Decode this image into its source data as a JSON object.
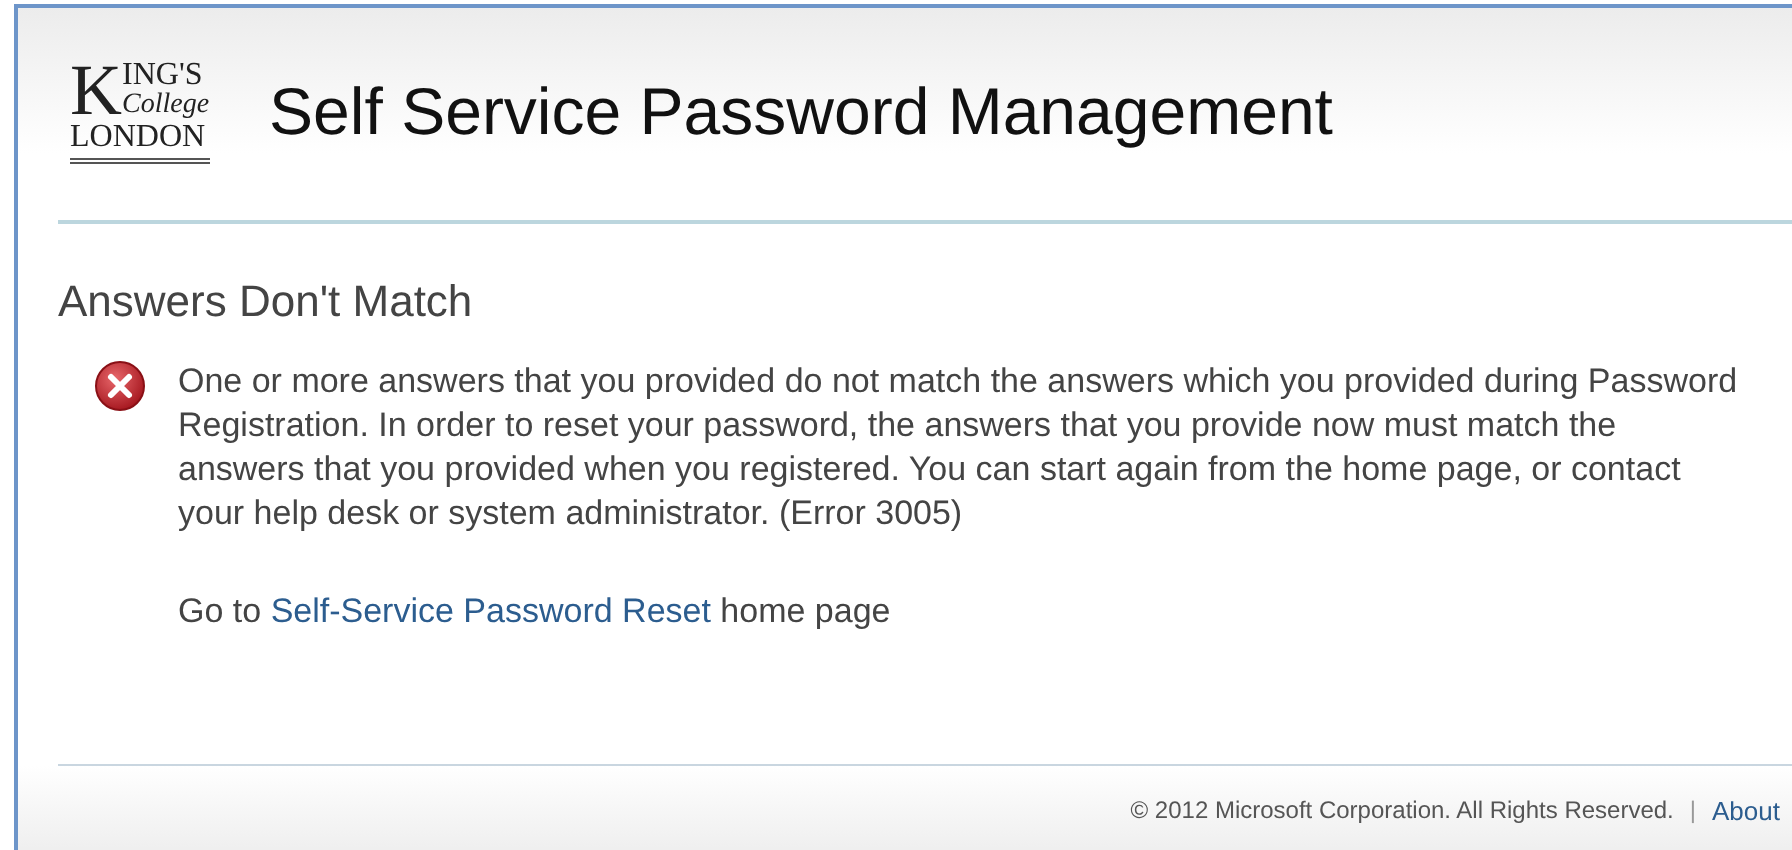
{
  "logo": {
    "initial": "K",
    "top": "ING'S",
    "middle": "College",
    "bottom": "LONDON"
  },
  "header": {
    "title": "Self Service Password Management"
  },
  "error": {
    "heading": "Answers Don't Match",
    "message": "One or more answers that you provided do not match the answers which you provided during Password Registration. In order to reset your password, the answers that you provide now must match the answers that you provided when you registered. You can start again from the home page, or contact your help desk or system administrator. (Error 3005)"
  },
  "home_link": {
    "before": "Go to",
    "link": "Self-Service Password Reset",
    "after": "home page"
  },
  "footer": {
    "copyright": "© 2012 Microsoft Corporation. All Rights Reserved.",
    "separator": "|",
    "about": "About"
  }
}
